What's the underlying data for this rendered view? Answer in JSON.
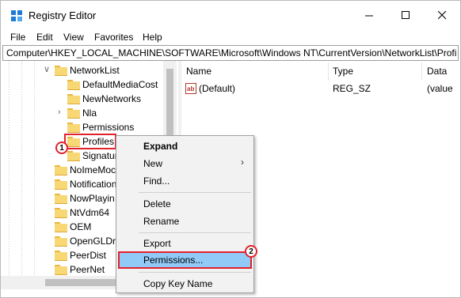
{
  "window": {
    "title": "Registry Editor",
    "controls": [
      "minimize-icon",
      "maximize-icon",
      "close-icon"
    ]
  },
  "menu": [
    "File",
    "Edit",
    "View",
    "Favorites",
    "Help"
  ],
  "address": "Computer\\HKEY_LOCAL_MACHINE\\SOFTWARE\\Microsoft\\Windows NT\\CurrentVersion\\NetworkList\\Profi",
  "tree": [
    {
      "label": "NetworkList",
      "expanded": true
    },
    {
      "label": "DefaultMediaCost"
    },
    {
      "label": "NewNetworks"
    },
    {
      "label": "Nla",
      "collapsed": true
    },
    {
      "label": "Permissions"
    },
    {
      "label": "Profiles",
      "selected": true
    },
    {
      "label": "Signatur"
    },
    {
      "label": "NoImeMoc"
    },
    {
      "label": "Notification"
    },
    {
      "label": "NowPlayin"
    },
    {
      "label": "NtVdm64"
    },
    {
      "label": "OEM"
    },
    {
      "label": "OpenGLDri"
    },
    {
      "label": "PeerDist"
    },
    {
      "label": "PeerNet"
    }
  ],
  "columns": {
    "name": "Name",
    "type": "Type",
    "data": "Data"
  },
  "values": [
    {
      "name": "(Default)",
      "type": "REG_SZ",
      "data": "(value"
    }
  ],
  "context_menu": {
    "expand": "Expand",
    "new": "New",
    "find": "Find...",
    "delete": "Delete",
    "rename": "Rename",
    "export": "Export",
    "permissions": "Permissions...",
    "copy_key_name": "Copy Key Name"
  },
  "annotations": {
    "step1": "1",
    "step2": "2"
  },
  "colors": {
    "highlight": "#91c9f7",
    "annotation_red": "#e1212d",
    "folder": "#f8d775"
  }
}
